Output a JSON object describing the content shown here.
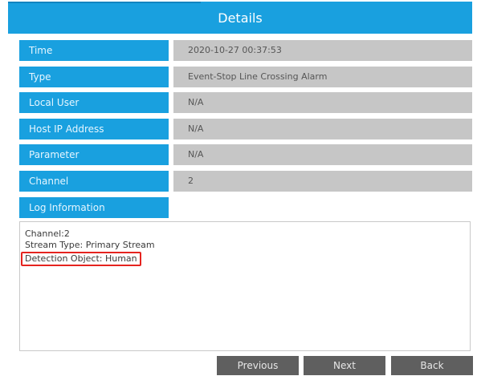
{
  "dialog": {
    "title": "Details"
  },
  "fields": [
    {
      "label": "Time",
      "value": "2020-10-27 00:37:53"
    },
    {
      "label": "Type",
      "value": "Event-Stop Line Crossing Alarm"
    },
    {
      "label": "Local User",
      "value": "N/A"
    },
    {
      "label": "Host IP Address",
      "value": "N/A"
    },
    {
      "label": "Parameter",
      "value": "N/A"
    },
    {
      "label": "Channel",
      "value": "2"
    }
  ],
  "log": {
    "label": "Log Information",
    "lines": [
      "Channel:2",
      "Stream Type: Primary Stream",
      "Detection Object: Human"
    ]
  },
  "buttons": {
    "previous": "Previous",
    "next": "Next",
    "back": "Back"
  },
  "colors": {
    "accent": "#19a0df",
    "value_bg": "#c6c6c6",
    "button_bg": "#5f5f5f",
    "highlight_border": "#e5231f"
  }
}
